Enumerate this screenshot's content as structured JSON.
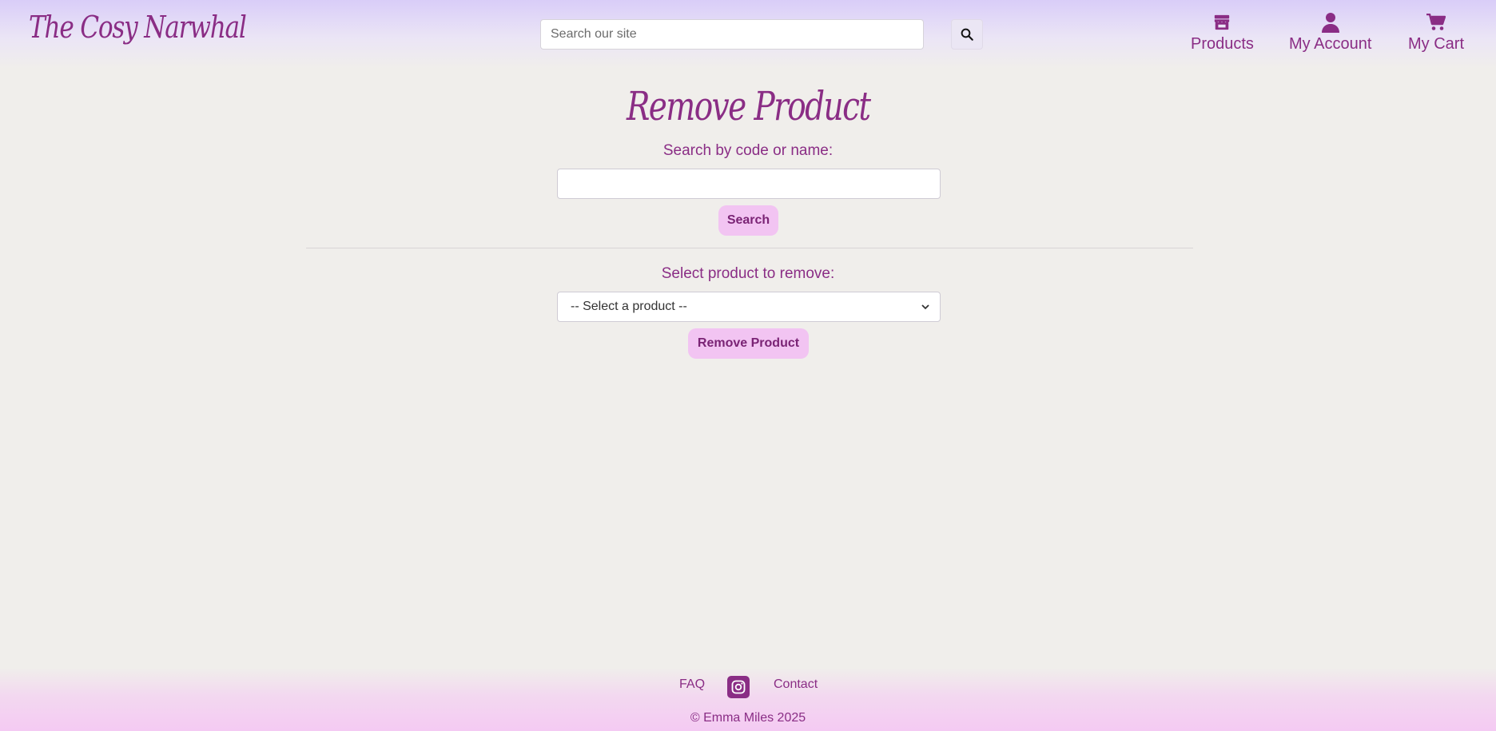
{
  "header": {
    "logo": "The Cosy Narwhal",
    "search": {
      "placeholder": "Search our site",
      "value": ""
    },
    "nav": [
      {
        "label": "Products",
        "icon": "store-icon"
      },
      {
        "label": "My Account",
        "icon": "user-icon"
      },
      {
        "label": "My Cart",
        "icon": "cart-icon"
      }
    ]
  },
  "main": {
    "title": "Remove Product",
    "search_label": "Search by code or name:",
    "search_value": "",
    "search_button": "Search",
    "select_label": "Select product to remove:",
    "select_value": "-- Select a product --",
    "remove_button": "Remove Product"
  },
  "footer": {
    "links": [
      "FAQ",
      "Contact"
    ],
    "social_icon": "instagram-icon",
    "copyright": "© Emma Miles 2025"
  },
  "colors": {
    "accent": "#8a2d85",
    "button_bg": "#f2c4f2",
    "page_bg": "#f0eeeb"
  }
}
